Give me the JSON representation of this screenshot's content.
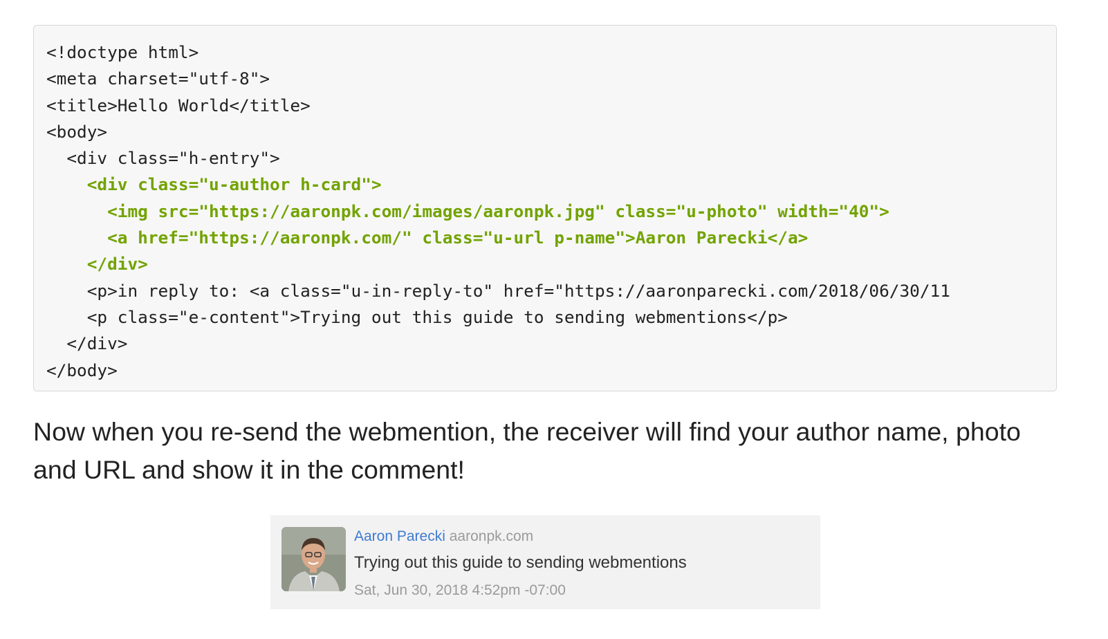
{
  "code": {
    "lines": [
      "<!doctype html>",
      "<meta charset=\"utf-8\">",
      "<title>Hello World</title>",
      "<body>",
      "  <div class=\"h-entry\">",
      "    <div class=\"u-author h-card\">",
      "      <img src=\"https://aaronpk.com/images/aaronpk.jpg\" class=\"u-photo\" width=\"40\">",
      "      <a href=\"https://aaronpk.com/\" class=\"u-url p-name\">Aaron Parecki</a>",
      "    </div>",
      "    <p>in reply to: <a class=\"u-in-reply-to\" href=\"https://aaronparecki.com/2018/06/30/11",
      "    <p class=\"e-content\">Trying out this guide to sending webmentions</p>",
      "  </div>",
      "</body>"
    ],
    "highlight_color": "#72a300"
  },
  "paragraph": {
    "text": "Now when you re-send the webmention, the receiver will find your author name, photo and URL and show it in the comment!"
  },
  "comment": {
    "author_name": "Aaron Parecki",
    "author_domain": "aaronpk.com",
    "content": "Trying out this guide to sending webmentions",
    "date": "Sat, Jun 30, 2018 4:52pm -07:00",
    "link_color": "#3d7bd1"
  }
}
